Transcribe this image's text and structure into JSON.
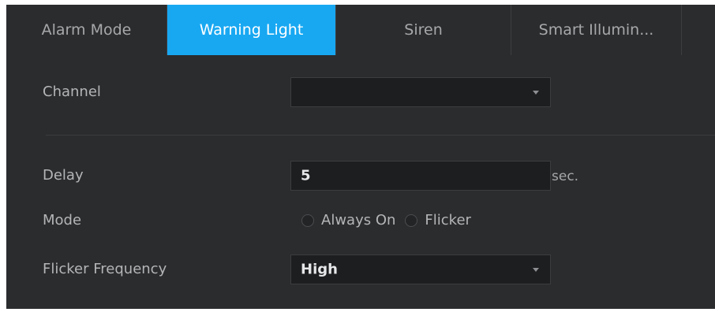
{
  "tabs": [
    {
      "label": "Alarm Mode",
      "active": false
    },
    {
      "label": "Warning Light",
      "active": true
    },
    {
      "label": "Siren",
      "active": false
    },
    {
      "label": "Smart Illumin...",
      "active": false
    }
  ],
  "form": {
    "channel": {
      "label": "Channel",
      "value": ""
    },
    "delay": {
      "label": "Delay",
      "value": "5",
      "unit": "sec."
    },
    "mode": {
      "label": "Mode",
      "options": [
        "Always On",
        "Flicker"
      ],
      "selected": null
    },
    "flicker_frequency": {
      "label": "Flicker Frequency",
      "value": "High"
    }
  },
  "colors": {
    "accent": "#18a8f2",
    "background": "#2b2c2e",
    "field_background": "#1d1e20"
  },
  "icons": {
    "dropdown": "chevron-down-icon",
    "radio": "radio-button-icon"
  }
}
